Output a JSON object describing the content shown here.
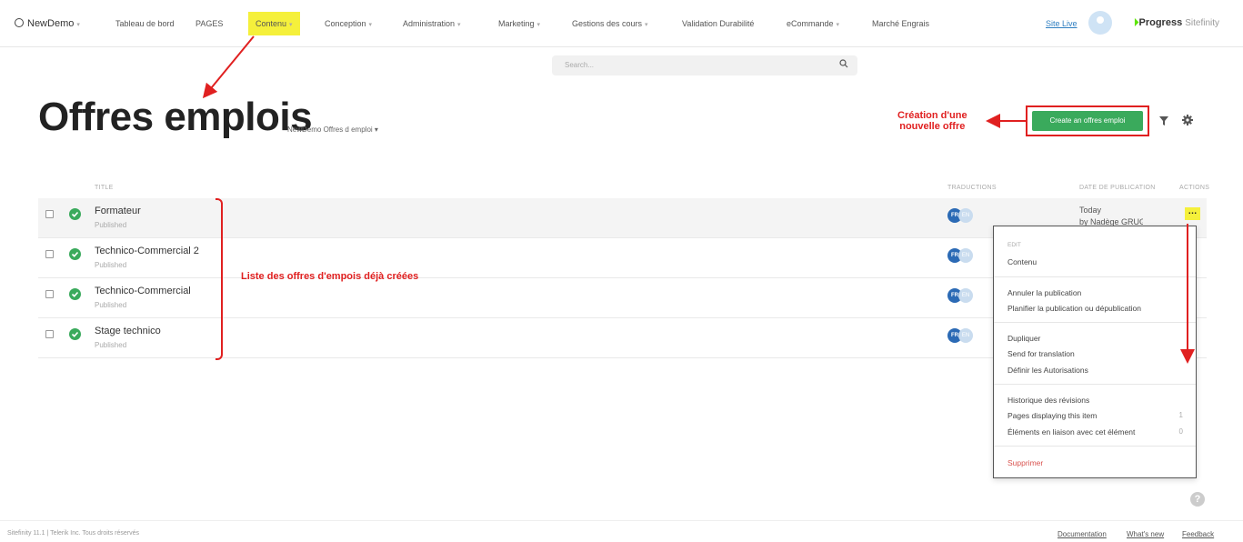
{
  "nav": {
    "brand": "NewDemo",
    "items": [
      "Tableau de bord",
      "PAGES",
      "Contenu",
      "Conception",
      "Administration",
      "Marketing",
      "Gestions des cours",
      "Validation Durabilité",
      "eCommande",
      "Marché Engrais"
    ],
    "site_live": "Site Live",
    "logo": "Progress",
    "logo_suffix": "Sitefinity"
  },
  "search": {
    "placeholder": "Search..."
  },
  "page": {
    "title": "Offres emplois",
    "subtitle": "NewDemo Offres d emploi"
  },
  "create_button": "Create an offres emploi",
  "annotations": {
    "create_line1": "Création d'une",
    "create_line2": "nouvelle offre",
    "list": "Liste des offres d'empois déjà créées"
  },
  "columns": {
    "title": "TITLE",
    "translations": "TRADUCTIONS",
    "date": "DATE DE PUBLICATION",
    "actions": "ACTIONS"
  },
  "rows": [
    {
      "name": "Formateur",
      "status": "Published",
      "date": "Today",
      "by": "by Nadège GRUGEN"
    },
    {
      "name": "Technico-Commercial 2",
      "status": "Published"
    },
    {
      "name": "Technico-Commercial",
      "status": "Published"
    },
    {
      "name": "Stage technico",
      "status": "Published"
    }
  ],
  "languages": {
    "fr": "FR",
    "en": "EN"
  },
  "menu": {
    "header": "EDIT",
    "items": {
      "content": "Contenu",
      "unpublish": "Annuler la publication",
      "schedule": "Planifier la publication ou dépublication",
      "duplicate": "Dupliquer",
      "send_translation": "Send for translation",
      "permissions": "Définir les Autorisations",
      "history": "Historique des révisions",
      "pages_displaying": "Pages displaying this item",
      "related": "Éléments en liaison avec cet élément",
      "delete": "Supprimer"
    },
    "counts": {
      "pages_displaying": "1",
      "related": "0"
    }
  },
  "footer": {
    "copyright": "Sitefinity 11.1 | Telerik Inc. Tous droits réservés",
    "links": [
      "Documentation",
      "What's new",
      "Feedback"
    ]
  },
  "colors": {
    "accent_green": "#3aaa5c",
    "highlight_yellow": "#f5f03b",
    "annotation_red": "#e02020"
  }
}
